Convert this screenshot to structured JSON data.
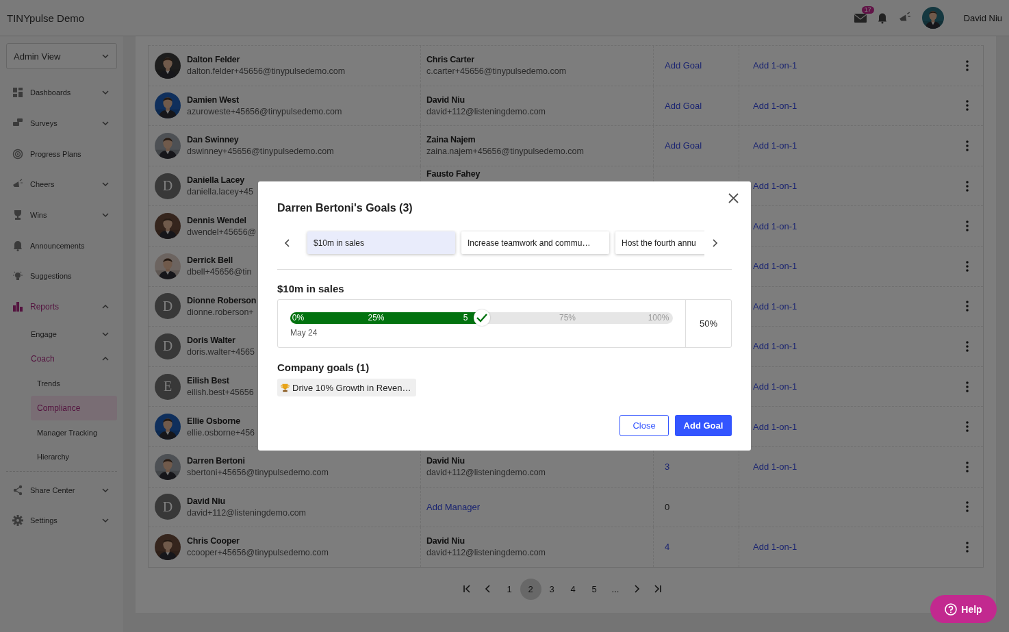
{
  "header": {
    "title": "TINYpulse Demo",
    "mail_badge": "17",
    "user_name": "David Niu"
  },
  "sidebar": {
    "view_select": "Admin View",
    "items": [
      {
        "label": "Dashboards",
        "expanded": false,
        "active": false,
        "selected": false
      },
      {
        "label": "Surveys",
        "expanded": false,
        "active": false,
        "selected": false
      },
      {
        "label": "Progress Plans",
        "active": false,
        "selected": false
      },
      {
        "label": "Cheers",
        "expanded": false,
        "active": false,
        "selected": false
      },
      {
        "label": "Wins",
        "expanded": false,
        "active": false,
        "selected": false
      },
      {
        "label": "Announcements",
        "active": false,
        "selected": false
      },
      {
        "label": "Suggestions",
        "active": false,
        "selected": false
      },
      {
        "label": "Reports",
        "expanded": true,
        "active": true,
        "selected": false,
        "children": [
          {
            "label": "Engage",
            "expanded": false,
            "active": false,
            "selected": false
          },
          {
            "label": "Coach",
            "expanded": true,
            "active": true,
            "selected": false,
            "children": [
              {
                "label": "Trends",
                "active": false,
                "selected": false
              },
              {
                "label": "Compliance",
                "active": true,
                "selected": true
              },
              {
                "label": "Manager Tracking",
                "active": false,
                "selected": false
              },
              {
                "label": "Hierarchy",
                "active": false,
                "selected": false
              }
            ]
          }
        ]
      }
    ],
    "bottom_items": [
      {
        "label": "Share Center",
        "expanded": false,
        "active": false,
        "selected": false
      },
      {
        "label": "Settings",
        "expanded": false,
        "active": false,
        "selected": false
      }
    ]
  },
  "table": {
    "rows": [
      {
        "name": "Dalton Felder",
        "email": "dalton.felder+45656@tinypulsedemo.com",
        "manager": {
          "kind": "person",
          "name": "Chris Carter",
          "email": "c.carter+45656@tinypulsedemo.com"
        },
        "goals": {
          "kind": "link",
          "label": "Add Goal"
        },
        "one_on_one": "Add 1-on-1"
      },
      {
        "name": "Damien West",
        "email": "azuroweste+45656@tinypulsedemo.com",
        "manager": {
          "kind": "person",
          "name": "David Niu",
          "email": "david+112@listeningdemo.com"
        },
        "goals": {
          "kind": "link",
          "label": "Add Goal"
        },
        "one_on_one": "Add 1-on-1"
      },
      {
        "name": "Dan Swinney",
        "email": "dswinney+45656@tinypulsedemo.com",
        "manager": {
          "kind": "person",
          "name": "Zaina Najem",
          "email": "zaina.najem+45656@tinypulsedemo.com"
        },
        "goals": {
          "kind": "link",
          "label": "Add Goal"
        },
        "one_on_one": "Add 1-on-1"
      },
      {
        "avatar": {
          "kind": "initial",
          "initial": "D"
        },
        "name": "Daniella Lacey",
        "email": "daniella.lacey+45",
        "manager": {
          "kind": "person",
          "name": "Fausto Fahey"
        },
        "one_on_one": "Add 1-on-1"
      },
      {
        "name": "Dennis Wendel",
        "email": "dwendel+45656@",
        "one_on_one": "Add 1-on-1"
      },
      {
        "name": "Derrick Bell",
        "email": "dbell+45656@tin",
        "one_on_one": "Add 1-on-1"
      },
      {
        "avatar": {
          "kind": "initial",
          "initial": "D"
        },
        "name": "Dionne Roberson",
        "email": "dionne.roberson+",
        "one_on_one": "Add 1-on-1"
      },
      {
        "avatar": {
          "kind": "initial",
          "initial": "D"
        },
        "name": "Doris Walter",
        "email": "doris.walter+4565",
        "one_on_one": "Add 1-on-1"
      },
      {
        "avatar": {
          "kind": "initial",
          "initial": "E"
        },
        "name": "Eilish Best",
        "email": "eilish.best+45656",
        "one_on_one": "Add 1-on-1"
      },
      {
        "name": "Ellie Osborne",
        "email": "ellie.osborne+456",
        "one_on_one": "Add 1-on-1"
      },
      {
        "name": "Darren Bertoni",
        "email": "sbertoni+45656@tinypulsedemo.com",
        "manager": {
          "kind": "person",
          "name": "David Niu",
          "email": "david+112@listeningdemo.com"
        },
        "goals": {
          "kind": "count_link",
          "label": "3"
        },
        "one_on_one": "Add 1-on-1"
      },
      {
        "avatar": {
          "kind": "initial",
          "initial": "D"
        },
        "name": "David Niu",
        "email": "david+112@listeningdemo.com",
        "manager": {
          "kind": "link",
          "label": "Add Manager"
        },
        "goals": {
          "kind": "count",
          "label": "0"
        }
      },
      {
        "name": "Chris Cooper",
        "email": "ccooper+45656@tinypulsedemo.com",
        "manager": {
          "kind": "person",
          "name": "David Niu",
          "email": "david+112@listeningdemo.com"
        },
        "goals": {
          "kind": "count_link",
          "label": "4"
        },
        "one_on_one": "Add 1-on-1"
      }
    ]
  },
  "pagination": {
    "pages": [
      {
        "label": "1",
        "selected": false
      },
      {
        "label": "2",
        "selected": true
      },
      {
        "label": "3",
        "selected": false
      },
      {
        "label": "4",
        "selected": false
      },
      {
        "label": "5",
        "selected": false
      }
    ],
    "ellipsis": "..."
  },
  "help_button": "Help",
  "modal": {
    "title": "Darren Bertoni's Goals (3)",
    "tabs": [
      {
        "label": "$10m in sales",
        "selected": true
      },
      {
        "label": "Increase teamwork and commu…",
        "selected": false
      },
      {
        "label": "Host the fourth annu",
        "selected": false
      }
    ],
    "goal": {
      "title": "$10m in sales",
      "level": 0.5,
      "ticks": [
        "0%",
        "25%",
        "5",
        "75%",
        "100%"
      ],
      "date": "May 24",
      "value": "50%"
    },
    "company_goals_title": "Company goals (1)",
    "company_goals": [
      {
        "label": "Drive 10% Growth in Reven…"
      }
    ],
    "buttons": [
      {
        "label": "Close",
        "kind": "secondary"
      },
      {
        "label": "Add Goal",
        "kind": "primary"
      }
    ]
  }
}
